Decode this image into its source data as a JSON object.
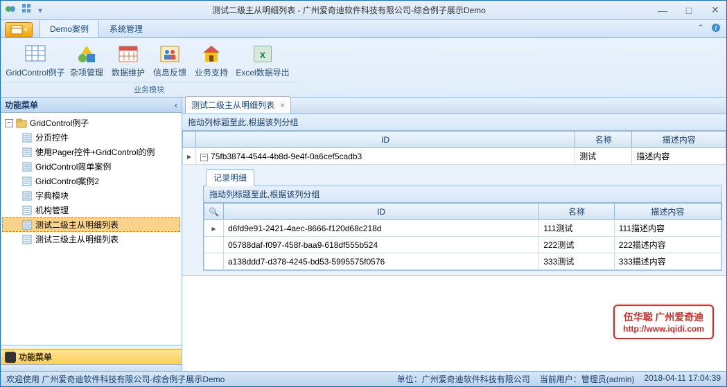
{
  "window": {
    "title": "测试二级主从明细列表 - 广州爱奇迪软件科技有限公司-综合例子展示Demo"
  },
  "ribbon": {
    "tabs": [
      "Demo案例",
      "系统管理"
    ],
    "active_tab": 0,
    "group_label": "业务模块",
    "buttons": [
      {
        "label": "GridControl例子",
        "icon": "grid"
      },
      {
        "label": "杂项管理",
        "icon": "shapes"
      },
      {
        "label": "数据维护",
        "icon": "calendar"
      },
      {
        "label": "信息反馈",
        "icon": "people"
      },
      {
        "label": "业务支持",
        "icon": "house"
      },
      {
        "label": "Excel数据导出",
        "icon": "excel"
      }
    ]
  },
  "sidebar": {
    "title": "功能菜单",
    "bottom_title": "功能菜单",
    "tree": {
      "root_label": "GridControl例子",
      "children": [
        {
          "label": "分页控件"
        },
        {
          "label": "使用Pager控件+GridControl的例"
        },
        {
          "label": "GridControl简单案例"
        },
        {
          "label": "GridControl案例2"
        },
        {
          "label": "字典模块"
        },
        {
          "label": "机构管理"
        },
        {
          "label": "测试二级主从明细列表",
          "selected": true
        },
        {
          "label": "测试三级主从明细列表"
        }
      ]
    }
  },
  "doc_tab": {
    "label": "测试二级主从明细列表"
  },
  "grid": {
    "group_hint": "拖动列标题至此,根据该列分组",
    "columns": [
      "ID",
      "名称",
      "描述内容"
    ],
    "rows": [
      {
        "id": "75fb3874-4544-4b8d-9e4f-0a6cef5cadb3",
        "name": "测试",
        "desc": "描述内容"
      }
    ],
    "detail": {
      "tab_label": "记录明细",
      "group_hint": "拖动列标题至此,根据该列分组",
      "columns": [
        "ID",
        "名称",
        "描述内容"
      ],
      "rows": [
        {
          "id": "d6fd9e91-2421-4aec-8666-f120d68c218d",
          "name": "111测试",
          "desc": "111描述内容"
        },
        {
          "id": "05788daf-f097-458f-baa9-618df555b524",
          "name": "222测试",
          "desc": "222描述内容"
        },
        {
          "id": "a138ddd7-d378-4245-bd53-5995575f0576",
          "name": "333测试",
          "desc": "333描述内容"
        }
      ]
    }
  },
  "watermark": {
    "line1": "伍华聪 广州爱奇迪",
    "line2": "http://www.iqidi.com"
  },
  "status": {
    "left": "欢迎使用 广州爱奇迪软件科技有限公司-综合例子展示Demo",
    "company": "单位：广州爱奇迪软件科技有限公司",
    "user": "当前用户：管理员(admin)",
    "datetime": "2018-04-11 17:04:39"
  }
}
